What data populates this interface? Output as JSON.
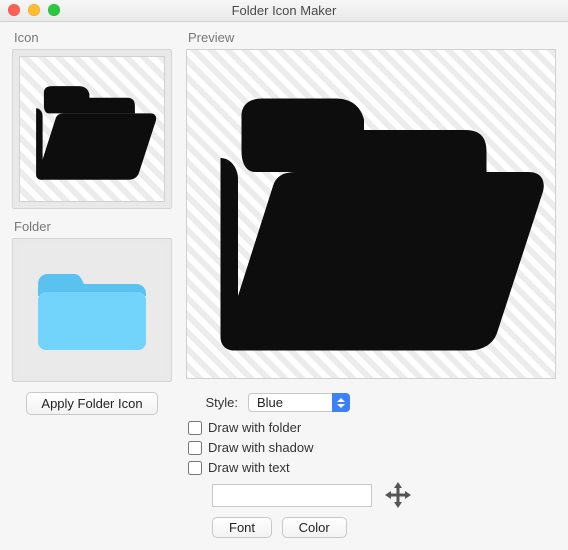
{
  "window": {
    "title": "Folder Icon Maker"
  },
  "labels": {
    "icon": "Icon",
    "folder": "Folder",
    "preview": "Preview",
    "style": "Style:"
  },
  "buttons": {
    "apply": "Apply Folder Icon",
    "font": "Font",
    "color": "Color"
  },
  "style_select": {
    "value": "Blue"
  },
  "checkboxes": {
    "draw_folder": {
      "label": "Draw with folder",
      "checked": false
    },
    "draw_shadow": {
      "label": "Draw with shadow",
      "checked": false
    },
    "draw_text": {
      "label": "Draw with text",
      "checked": false
    }
  },
  "text_input": {
    "value": "",
    "placeholder": ""
  },
  "colors": {
    "folder_fill": "#72d3fb",
    "folder_tab": "#5bc1ef",
    "icon_fill": "#0d0d0d"
  }
}
